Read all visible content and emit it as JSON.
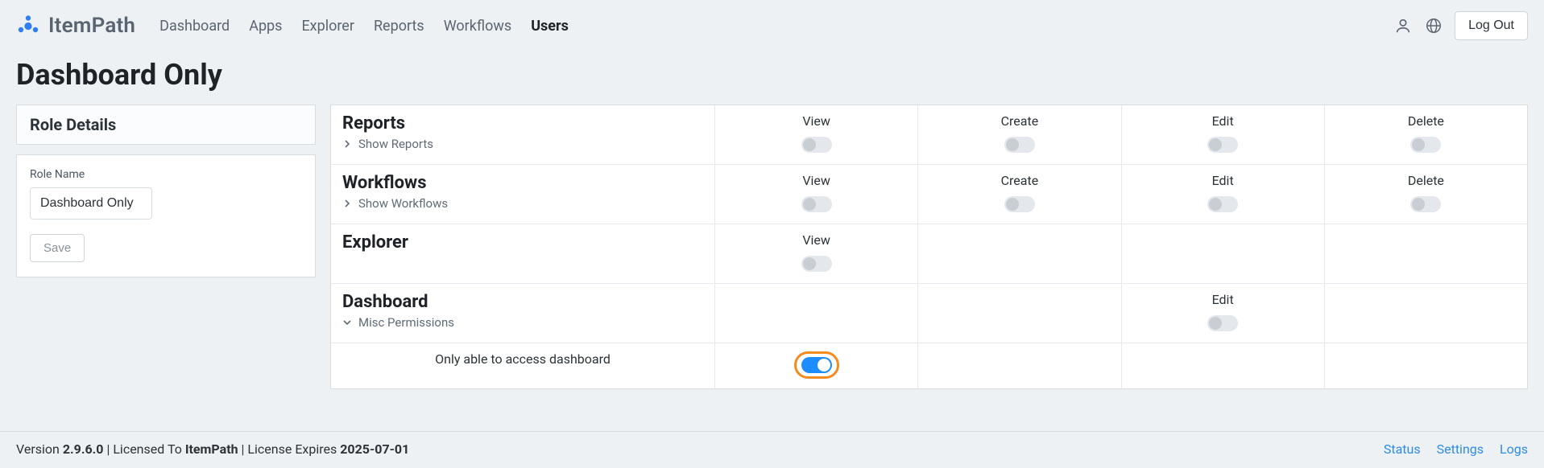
{
  "brand": {
    "name": "ItemPath"
  },
  "nav": {
    "items": [
      {
        "label": "Dashboard",
        "active": false
      },
      {
        "label": "Apps",
        "active": false
      },
      {
        "label": "Explorer",
        "active": false
      },
      {
        "label": "Reports",
        "active": false
      },
      {
        "label": "Workflows",
        "active": false
      },
      {
        "label": "Users",
        "active": true
      }
    ],
    "logout": "Log Out"
  },
  "page": {
    "title": "Dashboard Only"
  },
  "role_details": {
    "panel_title": "Role Details",
    "role_name_label": "Role Name",
    "role_name_value": "Dashboard Only",
    "save_label": "Save"
  },
  "perm_labels": {
    "view": "View",
    "create": "Create",
    "edit": "Edit",
    "delete": "Delete"
  },
  "sections": [
    {
      "name": "reports",
      "title": "Reports",
      "expand_label": "Show Reports",
      "expanded": false,
      "cols": {
        "view": {
          "show": true,
          "on": false
        },
        "create": {
          "show": true,
          "on": false
        },
        "edit": {
          "show": true,
          "on": false
        },
        "delete": {
          "show": true,
          "on": false
        }
      }
    },
    {
      "name": "workflows",
      "title": "Workflows",
      "expand_label": "Show Workflows",
      "expanded": false,
      "cols": {
        "view": {
          "show": true,
          "on": false
        },
        "create": {
          "show": true,
          "on": false
        },
        "edit": {
          "show": true,
          "on": false
        },
        "delete": {
          "show": true,
          "on": false
        }
      }
    },
    {
      "name": "explorer",
      "title": "Explorer",
      "cols": {
        "view": {
          "show": true,
          "on": false
        },
        "create": {
          "show": false
        },
        "edit": {
          "show": false
        },
        "delete": {
          "show": false
        }
      }
    },
    {
      "name": "dashboard",
      "title": "Dashboard",
      "expand_label": "Misc Permissions",
      "expanded": true,
      "cols": {
        "view": {
          "show": false
        },
        "create": {
          "show": false
        },
        "edit": {
          "show": true,
          "on": false
        },
        "delete": {
          "show": false
        }
      },
      "children": [
        {
          "label": "Only able to access dashboard",
          "col": "view",
          "on": true,
          "highlight": true
        }
      ]
    }
  ],
  "footer": {
    "version_prefix": "Version ",
    "version": "2.9.6.0",
    "licensed_prefix": " | Licensed To ",
    "licensed_to": "ItemPath",
    "expires_prefix": " | License Expires ",
    "expires": "2025-07-01",
    "links": {
      "status": "Status",
      "settings": "Settings",
      "logs": "Logs"
    }
  }
}
